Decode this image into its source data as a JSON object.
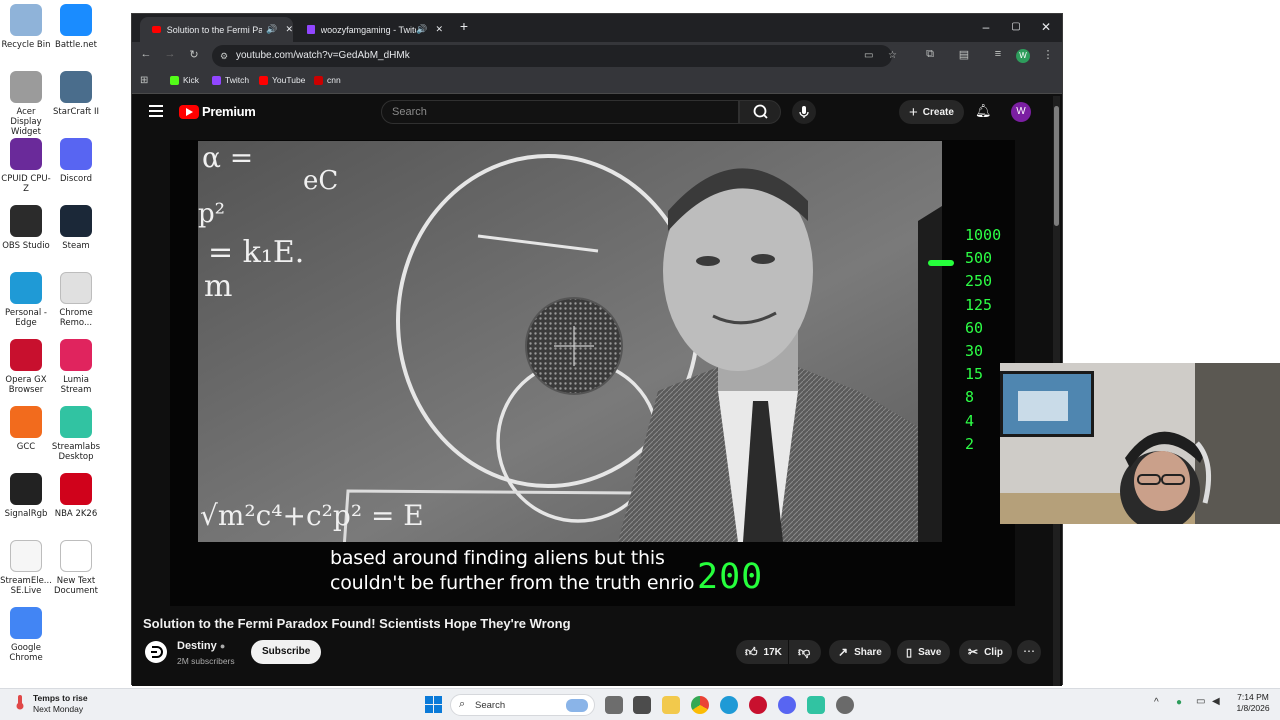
{
  "desktop_icons": [
    {
      "label": "Recycle Bin",
      "icon": "recycle-bin-icon",
      "color": "#8fb3d9"
    },
    {
      "label": "Battle.net",
      "icon": "battlenet-icon",
      "color": "#1a8cff"
    },
    {
      "label": "Acer Display Widget",
      "icon": "acer-icon",
      "color": "#9b9b9b"
    },
    {
      "label": "StarCraft II",
      "icon": "starcraft-icon",
      "color": "#4a6d8c"
    },
    {
      "label": "CPUID CPU-Z",
      "icon": "cpuz-icon",
      "color": "#6a2a9a"
    },
    {
      "label": "Discord",
      "icon": "discord-icon",
      "color": "#5865f2"
    },
    {
      "label": "OBS Studio",
      "icon": "obs-icon",
      "color": "#2b2b2b"
    },
    {
      "label": "Steam",
      "icon": "steam-icon",
      "color": "#1b2838"
    },
    {
      "label": "Personal - Edge",
      "icon": "edge-icon",
      "color": "#1f9ad6"
    },
    {
      "label": "Chrome Remo...",
      "icon": "chrome-remote-icon",
      "color": "#e0e0e0"
    },
    {
      "label": "Opera GX Browser",
      "icon": "opera-gx-icon",
      "color": "#c8102e"
    },
    {
      "label": "Lumia Stream",
      "icon": "lumia-icon",
      "color": "#e0245e"
    },
    {
      "label": "GCC",
      "icon": "gcc-icon",
      "color": "#f26b1d"
    },
    {
      "label": "Streamlabs Desktop",
      "icon": "streamlabs-icon",
      "color": "#31c3a2"
    },
    {
      "label": "SignalRgb",
      "icon": "signalrgb-icon",
      "color": "#222222"
    },
    {
      "label": "NBA 2K26",
      "icon": "nba2k-icon",
      "color": "#d0021b"
    },
    {
      "label": "StreamEle... SE.Live",
      "icon": "streamelements-icon",
      "color": "#f6f6f6"
    },
    {
      "label": "New Text Document",
      "icon": "text-document-icon",
      "color": "#ffffff"
    },
    {
      "label": "Google Chrome",
      "icon": "chrome-icon",
      "color": "#4285f4"
    }
  ],
  "browser": {
    "tabs": [
      {
        "label": "Solution to the Fermi Parad",
        "active": true
      },
      {
        "label": "woozyfamgaming - Twitch",
        "active": false
      }
    ],
    "new_tab": "+",
    "url": "youtube.com/watch?v=GedAbM_dHMk",
    "bookmarks": [
      {
        "label": "Kick",
        "color": "#53fc18"
      },
      {
        "label": "Twitch",
        "color": "#9146ff"
      },
      {
        "label": "YouTube",
        "color": "#ff0000"
      },
      {
        "label": "cnn",
        "color": "#cc0000"
      }
    ],
    "profile_letter": "W"
  },
  "youtube": {
    "logo_text": "Premium",
    "search_placeholder": "Search",
    "create_label": "Create",
    "avatar_letter": "W",
    "video_title": "Solution to the Fermi Paradox Found! Scientists Hope They're Wrong",
    "channel_name": "Destiny",
    "subscribers": "2M subscribers",
    "subscribe_label": "Subscribe",
    "likes": "17K",
    "share_label": "Share",
    "save_label": "Save",
    "clip_label": "Clip",
    "caption_line1": "based around finding aliens but this",
    "caption_line2": "couldn't be further from the truth enrio",
    "overlay_iso": "200",
    "overlay_scale": [
      "1000",
      "500",
      "250",
      "125",
      "60",
      "30",
      "15",
      "8",
      "4",
      "2"
    ],
    "blackboard_text": [
      "α =",
      "eC",
      "p²",
      "= k₁E.",
      "m",
      "√m²c⁴+c²p² = E"
    ],
    "accent": "#ff0000",
    "overlay_color": "#26ff3c"
  },
  "taskbar": {
    "weather_title": "Temps to rise",
    "weather_sub": "Next Monday",
    "search_label": "Search",
    "time": "7:14 PM",
    "date": "1/8/2026"
  }
}
